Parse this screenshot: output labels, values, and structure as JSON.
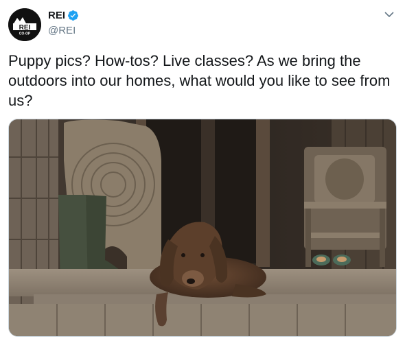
{
  "account": {
    "display_name": "REI",
    "handle": "@REI",
    "verified": true,
    "avatar_text": "REI",
    "avatar_subtext": "CO-OP"
  },
  "tweet": {
    "text": "Puppy pics? How-tos? Live classes? As we bring the outdoors into our homes, what would you like to see from us?"
  },
  "icons": {
    "verified": "verified-badge-icon",
    "more": "chevron-down-icon"
  },
  "colors": {
    "verified_blue": "#1da1f2",
    "text": "#14171a",
    "secondary": "#657786"
  }
}
